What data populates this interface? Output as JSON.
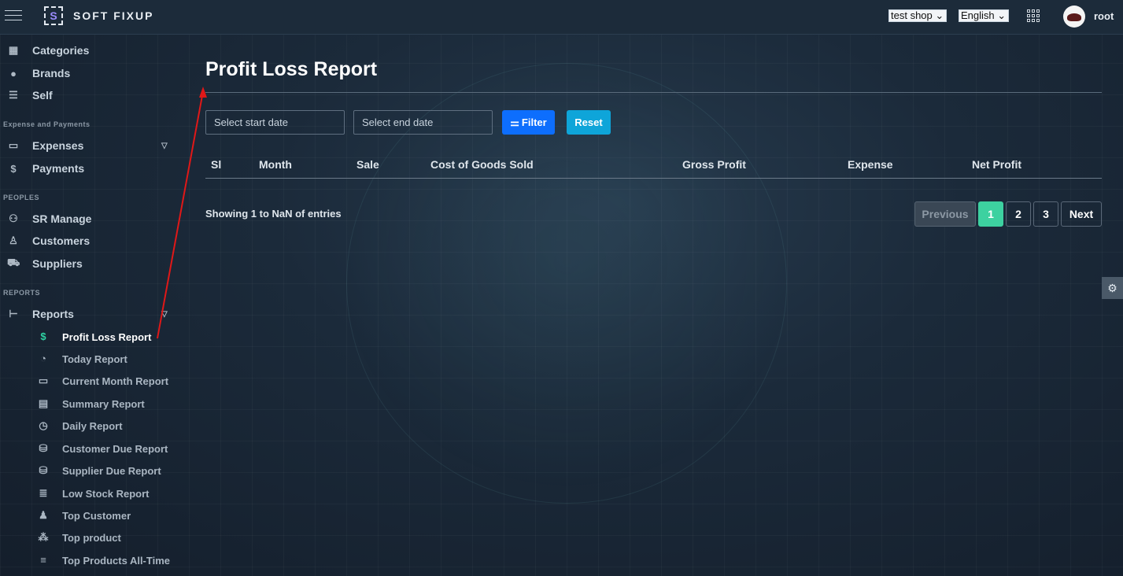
{
  "topbar": {
    "app_name": "SOFT FIXUP",
    "logo_letter": "S",
    "shop_select": "test shop",
    "language_select": "English",
    "user_name": "root"
  },
  "sidebar": {
    "items_top": [
      {
        "label": "Categories",
        "icon": "grid-icon"
      },
      {
        "label": "Brands",
        "icon": "badge-icon"
      },
      {
        "label": "Self",
        "icon": "shelf-icon"
      }
    ],
    "section_expense": "Expense and Payments",
    "expenses": "Expenses",
    "payments": "Payments",
    "section_peoples": "PEOPLES",
    "sr_manage": "SR Manage",
    "customers": "Customers",
    "suppliers": "Suppliers",
    "section_reports": "REPORTS",
    "reports": "Reports",
    "report_items": [
      "Profit Loss Report",
      "Today Report",
      "Current Month Report",
      "Summary Report",
      "Daily Report",
      "Customer Due Report",
      "Supplier Due Report",
      "Low Stock Report",
      "Top Customer",
      "Top product",
      "Top Products All-Time"
    ]
  },
  "main": {
    "title": "Profit Loss Report",
    "start_placeholder": "Select start date",
    "end_placeholder": "Select end date",
    "filter_label": "Filter",
    "reset_label": "Reset",
    "columns": [
      "Sl",
      "Month",
      "Sale",
      "Cost of Goods Sold",
      "Gross Profit",
      "Expense",
      "Net Profit"
    ],
    "showing": "Showing 1 to NaN of entries",
    "pagination": {
      "previous": "Previous",
      "pages": [
        "1",
        "2",
        "3"
      ],
      "next": "Next",
      "current_page": "1"
    }
  },
  "colors": {
    "accent_green": "#3dd1a0",
    "filter_blue": "#0d6efd",
    "reset_cyan": "#0ea5d9",
    "annotation_red": "#e01818"
  }
}
